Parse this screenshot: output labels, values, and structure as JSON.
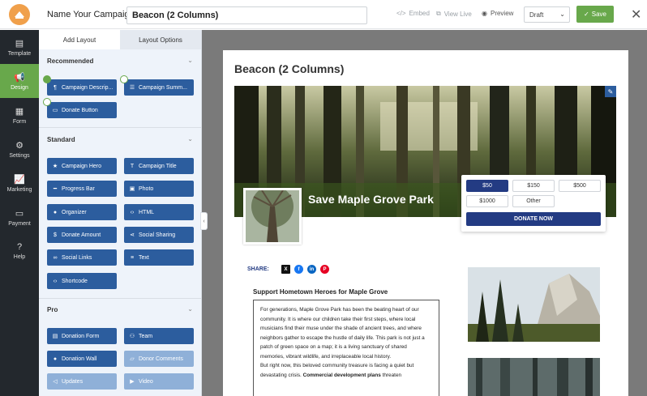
{
  "topbar": {
    "name_label": "Name Your Campaign:",
    "campaign_name": "Beacon (2 Columns)",
    "embed_label": "Embed",
    "view_live_label": "View Live",
    "preview_label": "Preview",
    "status": "Draft",
    "save_label": "Save"
  },
  "nav": {
    "items": [
      {
        "label": "Template",
        "icon": "template-icon"
      },
      {
        "label": "Design",
        "icon": "megaphone-icon"
      },
      {
        "label": "Form",
        "icon": "form-icon"
      },
      {
        "label": "Settings",
        "icon": "gear-icon"
      },
      {
        "label": "Marketing",
        "icon": "chart-icon"
      },
      {
        "label": "Payment",
        "icon": "card-icon"
      },
      {
        "label": "Help",
        "icon": "help-icon"
      }
    ]
  },
  "panel": {
    "tabs": [
      "Add Layout",
      "Layout Options"
    ],
    "sections": {
      "recommended": "Recommended",
      "standard": "Standard",
      "pro": "Pro"
    },
    "recommended_blocks": [
      "Campaign Descrip...",
      "Campaign Summ...",
      "Donate Button"
    ],
    "standard_blocks": [
      "Campaign Hero",
      "Campaign Title",
      "Progress Bar",
      "Photo",
      "Organizer",
      "HTML",
      "Donate Amount",
      "Social Sharing",
      "Social Links",
      "Text",
      "Shortcode"
    ],
    "pro_blocks": [
      "Donation Form",
      "Team",
      "Donation Wall",
      "Donor Comments",
      "Updates",
      "Video"
    ]
  },
  "page": {
    "title": "Beacon (2 Columns)",
    "campaign_name": "Save Maple Grove Park",
    "amounts": [
      "$50",
      "$150",
      "$500",
      "$1000",
      "Other"
    ],
    "donate_label": "DONATE NOW",
    "share_label": "SHARE:",
    "social": [
      "X",
      "f",
      "in",
      "P"
    ],
    "content_heading": "Support Hometown Heroes for Maple Grove",
    "para1": "For generations, Maple Grove Park has been the beating heart of our community. It is where our children take their first steps, where local musicians find their muse under the shade of ancient trees, and where neighbors gather to escape the hustle of daily life. This park is not just a patch of green space on a map; it is a living sanctuary of shared memories, vibrant wildlife, and irreplaceable local history.",
    "para2_start": "But right now, this beloved community treasure is facing a quiet but devastating crisis. ",
    "para2_bold": "Commercial development plans",
    "para2_end": " threaten"
  },
  "colors": {
    "accent_green": "#68a84b",
    "block_blue": "#2c5d9e",
    "donate_navy": "#233b83",
    "nav_dark": "#23282d"
  }
}
